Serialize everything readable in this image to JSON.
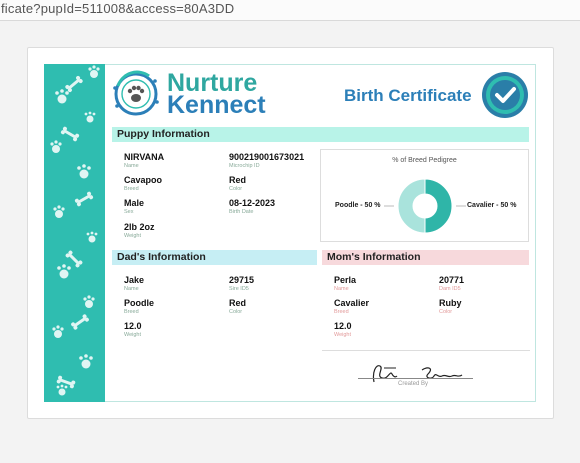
{
  "browser": {
    "url": "ficate?pupId=511008&access=80A3DD"
  },
  "brand": {
    "line1": "Nurture",
    "line2": "Kennect"
  },
  "certificate": {
    "title": "Birth Certificate"
  },
  "sections": {
    "puppy": "Puppy Information",
    "dad": "Dad's Information",
    "mom": "Mom's Information"
  },
  "puppy": {
    "name": "NIRVANA",
    "name_label": "Name",
    "microchip": "900219001673021",
    "microchip_label": "Microchip ID",
    "breed": "Cavapoo",
    "breed_label": "Breed",
    "color": "Red",
    "color_label": "Color",
    "sex": "Male",
    "sex_label": "Sex",
    "birth_date": "08-12-2023",
    "birth_date_label": "Birth Date",
    "weight": "2lb 2oz",
    "weight_label": "Weight"
  },
  "dad": {
    "name": "Jake",
    "name_label": "Name",
    "id": "29715",
    "id_label": "Sire ID5",
    "breed": "Poodle",
    "breed_label": "Breed",
    "color": "Red",
    "color_label": "Color",
    "weight": "12.0",
    "weight_label": "Weight"
  },
  "mom": {
    "name": "Perla",
    "name_label": "Name",
    "id": "20771",
    "id_label": "Dam ID5",
    "breed": "Cavalier",
    "breed_label": "Breed",
    "color": "Ruby",
    "color_label": "Color",
    "weight": "12.0",
    "weight_label": "Weight"
  },
  "pedigree": {
    "title": "% of Breed Pedigree",
    "left_label": "Poodle - 50 %",
    "right_label": "Cavalier - 50 %"
  },
  "chart_data": {
    "type": "pie",
    "title": "% of Breed Pedigree",
    "categories": [
      "Poodle",
      "Cavalier"
    ],
    "values": [
      50,
      50
    ]
  },
  "signature": {
    "label": "Created By"
  },
  "colors": {
    "teal": "#2fbdb0",
    "title_blue": "#2c7fb8",
    "mint": "#b8f3e8",
    "dad_bg": "#c6eef4",
    "mom_bg": "#f7d9dc"
  }
}
